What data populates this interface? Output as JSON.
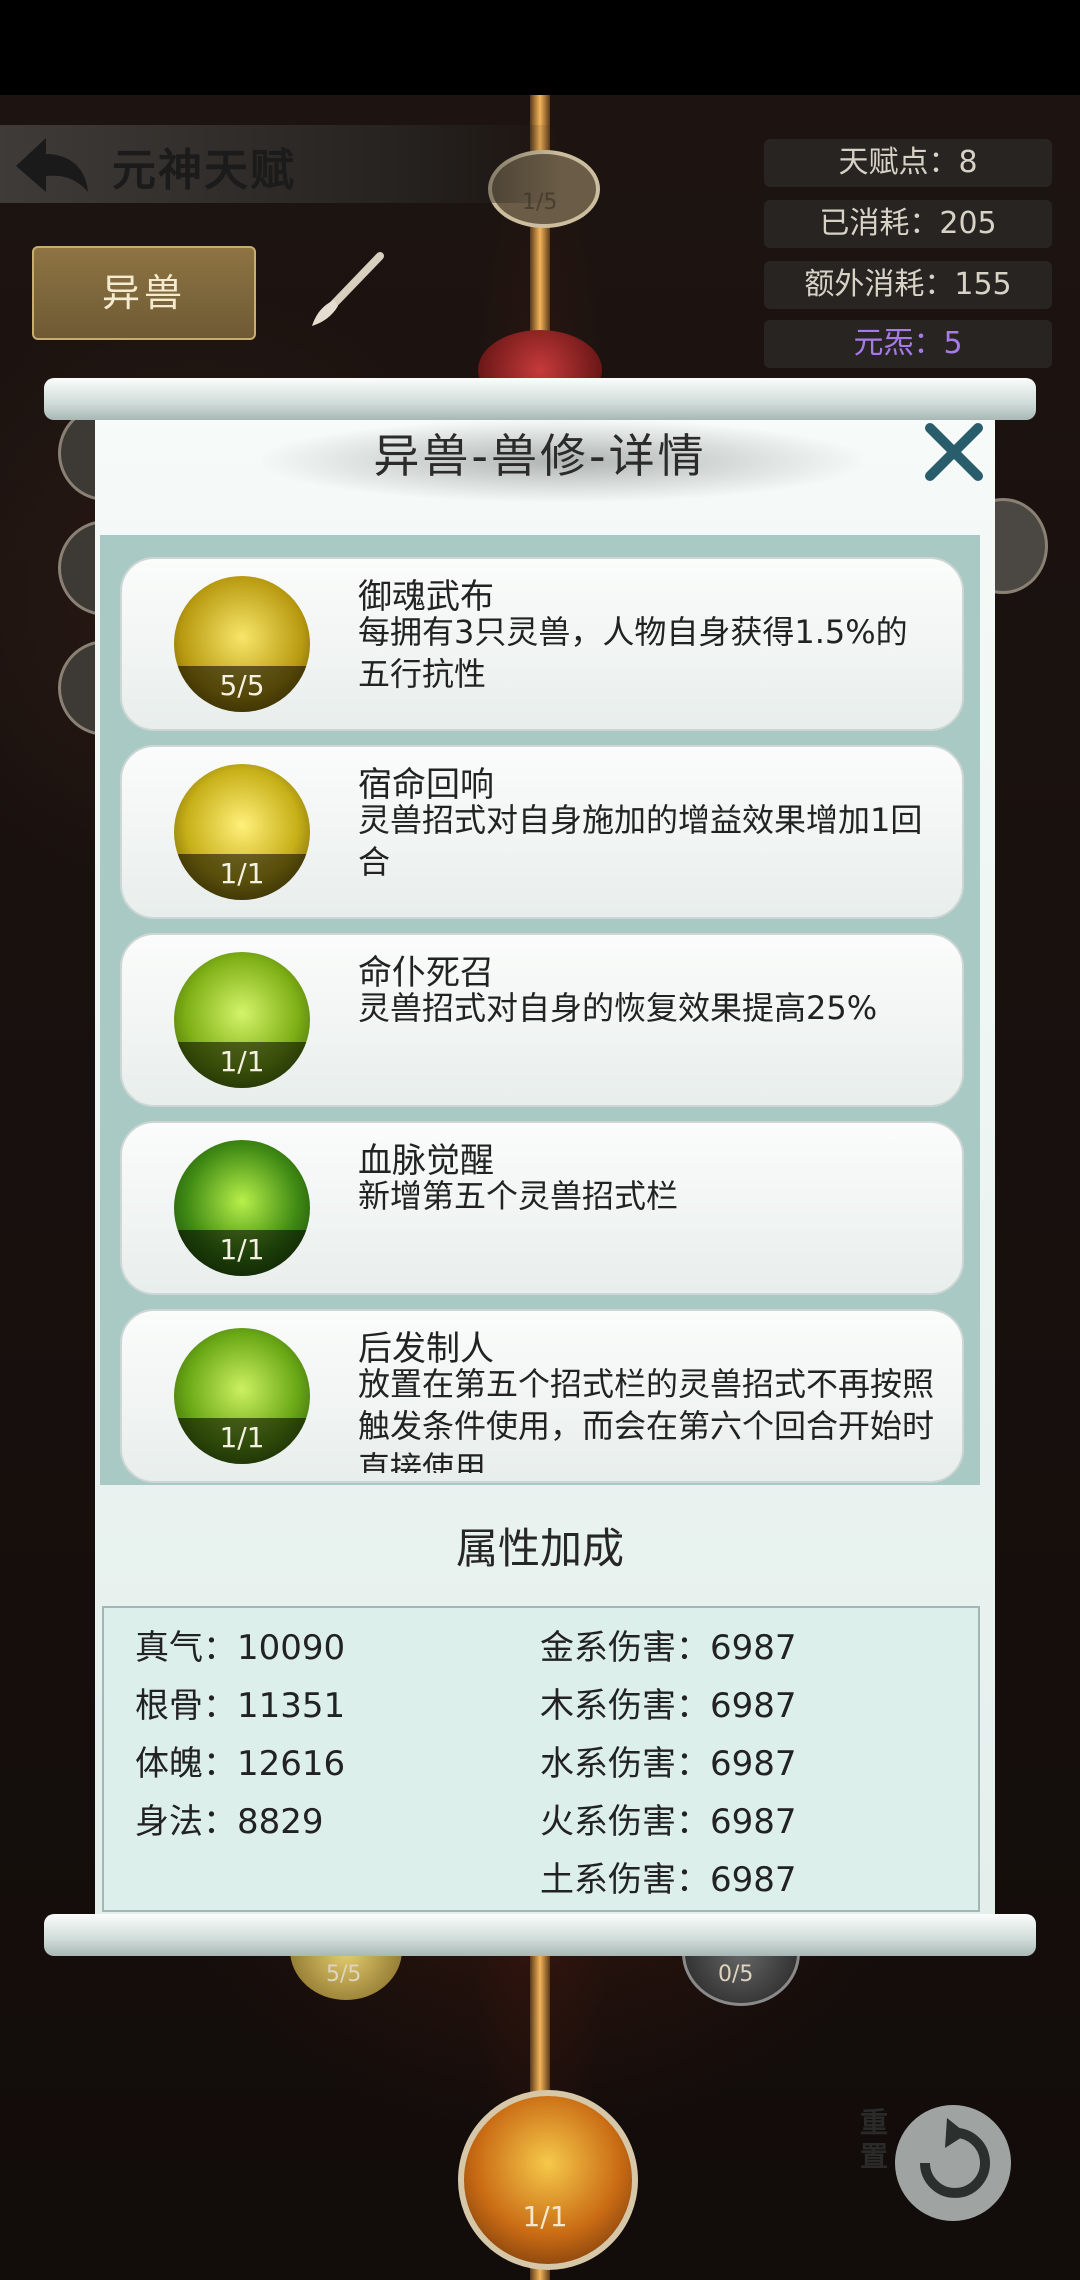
{
  "header": {
    "title": "元神天赋",
    "tab_label": "异兽"
  },
  "stats": {
    "talent_points": "天赋点：8",
    "consumed": "已消耗：205",
    "extra_consumed": "额外消耗：155",
    "yuanliao": "元炁：5"
  },
  "panel": {
    "title": "异兽-兽修-详情",
    "talents": [
      {
        "name": "御魂武布",
        "desc": "每拥有3只灵兽，人物自身获得1.5%的五行抗性",
        "level": "5/5"
      },
      {
        "name": "宿命回响",
        "desc": "灵兽招式对自身施加的增益效果增加1回合",
        "level": "1/1"
      },
      {
        "name": "命仆死召",
        "desc": "灵兽招式对自身的恢复效果提高25%",
        "level": "1/1"
      },
      {
        "name": "血脉觉醒",
        "desc": "新增第五个灵兽招式栏",
        "level": "1/1"
      },
      {
        "name": "后发制人",
        "desc": "放置在第五个招式栏的灵兽招式不再按照触发条件使用，而会在第六个回合开始时直接使用",
        "level": "1/1"
      }
    ],
    "attr_heading": "属性加成",
    "attributes_left": [
      "真气：10090",
      "根骨：11351",
      "体魄：12616",
      "身法：8829"
    ],
    "attributes_right": [
      "金系伤害：6987",
      "木系伤害：6987",
      "水系伤害：6987",
      "火系伤害：6987",
      "土系伤害：6987"
    ]
  },
  "tree": {
    "top_node_label": "1/5",
    "left_node_label": "5/5",
    "right_node_label": "0/5",
    "bottom_node_label": "1/1",
    "reset_label": "重置"
  },
  "icons": [
    "back-arrow-icon",
    "brush-icon",
    "close-icon",
    "search-icon",
    "reset-icon"
  ],
  "colors": {
    "accent_gold": "#8e7443",
    "purple": "#a67ae8",
    "panel_teal": "#a8c9c4"
  }
}
